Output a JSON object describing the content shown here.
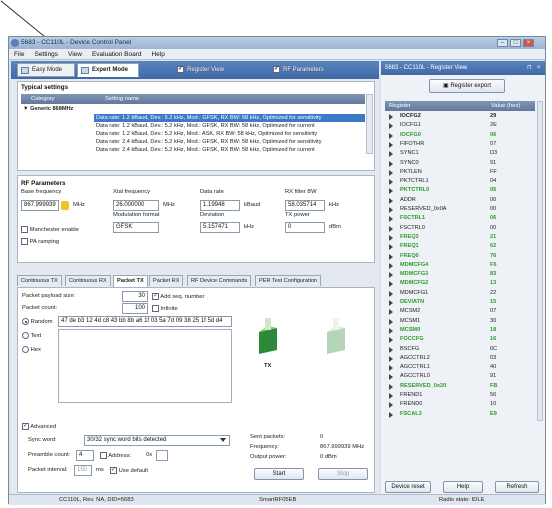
{
  "window": {
    "title": "5683 - CC110L - Device Control Panel"
  },
  "menu": [
    "File",
    "Settings",
    "View",
    "Evaluation Board",
    "Help"
  ],
  "modes": {
    "easy": "Easy Mode",
    "expert": "Expert Mode"
  },
  "view_toggles": {
    "register_view": "Register View",
    "rf_parameters": "RF Parameters"
  },
  "typical": {
    "title": "Typical settings",
    "col_category": "Category",
    "col_setting": "Setting name",
    "group": "Generic 868MHz",
    "rows": [
      "Data rate: 1.2 kBaud,  Dev.: 5.2 kHz,  Mod.: GFSK, RX BW: 58 kHz,  Optimized for sensitivity",
      "Data rate: 1.2 kBaud,  Dev.: 5.2 kHz,  Mod.: GFSK, RX BW: 58 kHz,  Optimized for current",
      "Data rate: 1.2 kBaud,  Dev.: 5.2 kHz,  Mod.: ASK,  RX BW: 58 kHz,  Optimized for sensitivity",
      "Data rate: 2.4 kBaud,  Dev.: 5.2 kHz,  Mod.: GFSK, RX BW: 58 kHz,  Optimized for sensitivity",
      "Data rate: 2.4 kBaud,  Dev.: 5.2 kHz,  Mod.: GFSK, RX BW: 58 kHz,  Optimized for current"
    ]
  },
  "rf": {
    "title": "RF Parameters",
    "base_freq_label": "Base frequency",
    "base_freq": "867.999939",
    "mhz": "MHz",
    "xtal_label": "Xtal frequency",
    "xtal": "26.000000",
    "data_rate_label": "Data rate",
    "data_rate": "1.19948",
    "kbaud": "kBaud",
    "rxbw_label": "RX filter BW",
    "rxbw": "58.035714",
    "khz": "kHz",
    "modulation_label": "Modulation format",
    "modulation": "GFSK",
    "deviation_label": "Deviation",
    "deviation": "5.157471",
    "txpower_label": "TX power",
    "txpower": "0",
    "dbm": "dBm",
    "manchester": "Manchester enable",
    "pa_ramping": "PA ramping"
  },
  "tabs": [
    "Continuous TX",
    "Continuous RX",
    "Packet TX",
    "Packet RX",
    "RF Device Commands",
    "PER Test Configuration"
  ],
  "packet": {
    "payload_label": "Packet payload size:",
    "payload": "30",
    "add_seq": "Add seq. number",
    "count_label": "Packet count:",
    "count": "100",
    "infinite": "Infinite",
    "random_label": "Random",
    "random_value": "47 de b3 12 4d c8 43 bb 8b a6 1f 03 5a 7d 09 38 25 1f 5d d4",
    "text_label": "Text",
    "hex_label": "Hex",
    "tx_label": "TX",
    "advanced": "Advanced",
    "sync_label": "Sync word:",
    "sync_value": "30/32 sync word bits detected",
    "preamble_label": "Preamble count:",
    "preamble": "4",
    "address_label": "Address:",
    "address_prefix": "0x",
    "interval_label": "Packet interval:",
    "interval": "150",
    "ms": "ms",
    "use_default": "Use default",
    "sent_label": "Sent packets:",
    "sent": "0",
    "freq_label": "Frequency:",
    "freq": "867.999939 MHz",
    "outpow_label": "Output power:",
    "outpow": "0 dBm",
    "start": "Start",
    "stop": "Stop"
  },
  "register": {
    "title": "5683 - CC110L - Register View",
    "export": "Register export",
    "col_register": "Register",
    "col_value": "Value (hex)",
    "rows": [
      {
        "n": "IOCFG2",
        "v": "29",
        "g": false
      },
      {
        "n": "IOCFG1",
        "v": "2E",
        "g": false
      },
      {
        "n": "IOCFG0",
        "v": "06",
        "g": true
      },
      {
        "n": "FIFOTHR",
        "v": "07",
        "g": false
      },
      {
        "n": "SYNC1",
        "v": "D3",
        "g": false
      },
      {
        "n": "SYNC0",
        "v": "91",
        "g": false
      },
      {
        "n": "PKTLEN",
        "v": "FF",
        "g": false
      },
      {
        "n": "PKTCTRL1",
        "v": "04",
        "g": false
      },
      {
        "n": "PKTCTRL0",
        "v": "05",
        "g": true
      },
      {
        "n": "ADDR",
        "v": "00",
        "g": false
      },
      {
        "n": "RESERVED_0x0A",
        "v": "00",
        "g": false
      },
      {
        "n": "FSCTRL1",
        "v": "06",
        "g": true
      },
      {
        "n": "FSCTRL0",
        "v": "00",
        "g": false
      },
      {
        "n": "FREQ2",
        "v": "21",
        "g": true
      },
      {
        "n": "FREQ1",
        "v": "62",
        "g": true
      },
      {
        "n": "FREQ0",
        "v": "76",
        "g": true
      },
      {
        "n": "MDMCFG4",
        "v": "F5",
        "g": true
      },
      {
        "n": "MDMCFG3",
        "v": "83",
        "g": true
      },
      {
        "n": "MDMCFG2",
        "v": "13",
        "g": true
      },
      {
        "n": "MDMCFG1",
        "v": "22",
        "g": false
      },
      {
        "n": "DEVIATN",
        "v": "15",
        "g": true
      },
      {
        "n": "MCSM2",
        "v": "07",
        "g": false
      },
      {
        "n": "MCSM1",
        "v": "30",
        "g": false
      },
      {
        "n": "MCSM0",
        "v": "18",
        "g": true
      },
      {
        "n": "FOCCFG",
        "v": "16",
        "g": true
      },
      {
        "n": "BSCFG",
        "v": "6C",
        "g": false
      },
      {
        "n": "AGCCTRL2",
        "v": "03",
        "g": false
      },
      {
        "n": "AGCCTRL1",
        "v": "40",
        "g": false
      },
      {
        "n": "AGCCTRL0",
        "v": "91",
        "g": false
      },
      {
        "n": "RESERVED_0x20",
        "v": "FB",
        "g": true
      },
      {
        "n": "FREND1",
        "v": "56",
        "g": false
      },
      {
        "n": "FREND0",
        "v": "10",
        "g": false
      },
      {
        "n": "FSCAL3",
        "v": "E9",
        "g": true
      }
    ],
    "device_reset": "Device reset",
    "help": "Help",
    "refresh": "Refresh"
  },
  "status": {
    "device": "CC110L, Rev. NA, DID=5683",
    "board": "SmartRF05EB",
    "radio": "Radio state: IDLE"
  },
  "colors": {
    "green": "#2f9a2f",
    "selected": "#3d78c9"
  }
}
